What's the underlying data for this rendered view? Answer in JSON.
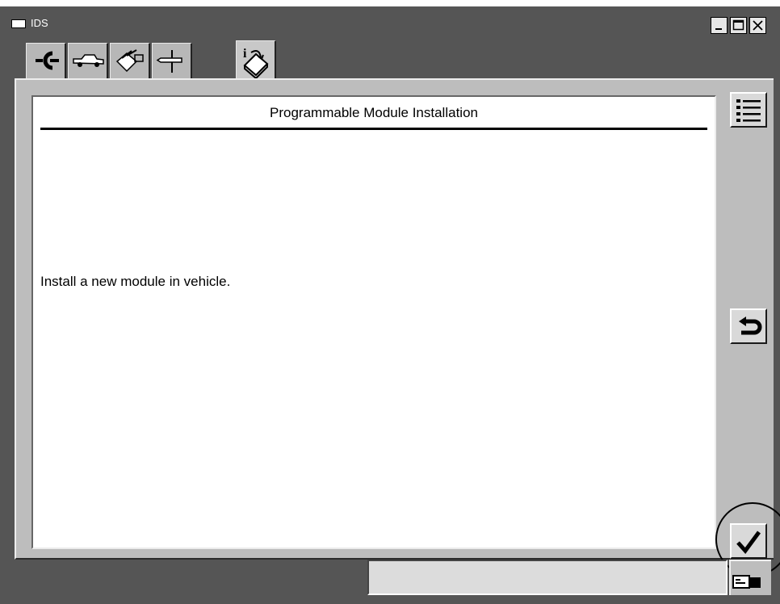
{
  "window": {
    "title": "IDS"
  },
  "tabs": [
    {
      "icon": "connector-icon"
    },
    {
      "icon": "vehicle-icon"
    },
    {
      "icon": "toolbox-icon"
    },
    {
      "icon": "signpost-icon"
    },
    {
      "icon": "info-book-icon",
      "active": true
    }
  ],
  "content": {
    "title": "Programmable Module Installation",
    "instruction": "Install a new module in vehicle."
  },
  "sidebar": {
    "list_icon": "list-icon",
    "back_icon": "return-arrow-icon",
    "confirm_icon": "checkmark-icon"
  },
  "status": {
    "text": ""
  }
}
